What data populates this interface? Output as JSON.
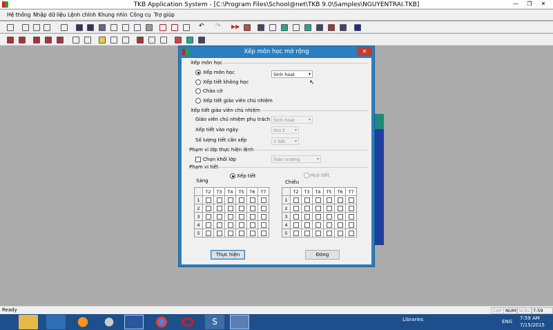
{
  "app": {
    "title": "TKB Application System - [C:\\Program Files\\School@net\\TKB 9.0\\Samples\\NGUYENTRAI.TKB]",
    "window_buttons": {
      "minimize": "—",
      "restore": "❐",
      "close": "✕"
    }
  },
  "menu": [
    "Hệ thống",
    "Nhập dữ liệu",
    "Lệnh chính",
    "Khung nhìn",
    "Công cụ",
    "Trợ giúp"
  ],
  "dialog": {
    "title": "Xếp môn học mở rộng",
    "close": "✕",
    "section_subject": "Xếp môn học",
    "radios": [
      {
        "label": "Xếp môn học",
        "checked": true
      },
      {
        "label": "Xếp tiết không học",
        "checked": false
      },
      {
        "label": "Chào cờ",
        "checked": false
      },
      {
        "label": "Xếp tiết giáo viên chủ nhiệm",
        "checked": false
      }
    ],
    "subject_combo": "Sinh hoạt",
    "section_homeroom": "Xếp tiết giáo viên chủ nhiệm",
    "homeroom_teacher_label": "Giáo viên chủ nhiệm phụ trách môn",
    "homeroom_teacher_value": "Sinh hoạt",
    "day_label": "Xếp tiết vào ngày",
    "day_value": "thứ 2",
    "count_label": "Số lượng tiết cần xếp",
    "count_value": "1 tiết",
    "section_scope": "Phạm vi lớp thực hiện lệnh",
    "grade_checkbox": "Chọn khối lớp",
    "grade_value": "Toàn trường",
    "section_period": "Phạm vi tiết",
    "mode_arrange": "Xếp tiết",
    "mode_cancel": "Huỷ tiết",
    "morning": "Sáng",
    "afternoon": "Chiều",
    "days": [
      "T2",
      "T3",
      "T4",
      "T5",
      "T6",
      "T7"
    ],
    "periods": [
      "1",
      "2",
      "3",
      "4",
      "5"
    ],
    "execute_button": "Thực hiện",
    "close_button": "Đóng"
  },
  "status": {
    "left": "Ready",
    "cap": "CAP",
    "num": "NUM",
    "scrl": "SCRL",
    "time": "7:59 AM"
  },
  "taskbar": {
    "libraries": "Libraries",
    "lang": "ENG",
    "time": "7:59 AM",
    "date": "7/15/2015"
  },
  "colors": {
    "dialog_frame": "#2a7fbc",
    "taskbar": "#1c4f8c",
    "close_red": "#c7392f"
  }
}
